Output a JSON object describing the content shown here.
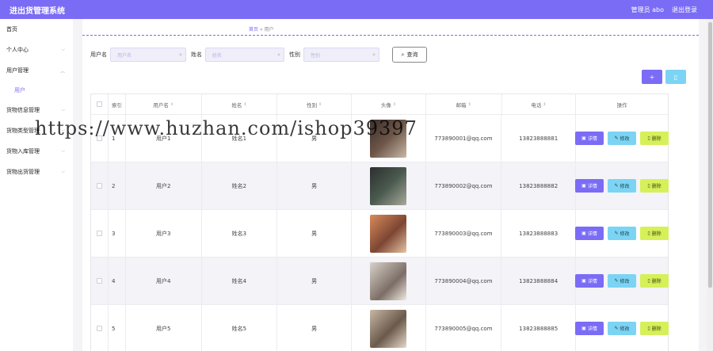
{
  "header": {
    "title": "进出货管理系统",
    "role_user": "管理员 abo",
    "logout": "退出登录"
  },
  "sidebar": {
    "items": [
      {
        "label": "首页",
        "has_chevron": false
      },
      {
        "label": "个人中心",
        "has_chevron": true
      },
      {
        "label": "用户管理",
        "has_chevron": true,
        "sub": "用户"
      },
      {
        "label": "货物信息管理",
        "has_chevron": true
      },
      {
        "label": "货物类型管理",
        "has_chevron": true
      },
      {
        "label": "货物入库管理",
        "has_chevron": true
      },
      {
        "label": "货物出货管理",
        "has_chevron": true
      }
    ]
  },
  "breadcrumb": {
    "home": "首页",
    "sep": "»",
    "current": "用户"
  },
  "search": {
    "username_label": "用户名",
    "username_placeholder": "用户名",
    "name_label": "姓名",
    "name_placeholder": "姓名",
    "gender_label": "性别",
    "gender_placeholder": "性别",
    "button": "查询"
  },
  "toolbar": {
    "add_icon": "plus-icon",
    "delete_icon": "trash-icon"
  },
  "table": {
    "headers": {
      "index": "索引",
      "username": "用户名",
      "name": "姓名",
      "gender": "性别",
      "avatar": "头像",
      "email": "邮箱",
      "phone": "电话",
      "ops": "操作"
    },
    "rows": [
      {
        "index": "1",
        "username": "用户1",
        "name": "姓名1",
        "gender": "男",
        "email": "773890001@qq.com",
        "phone": "13823888881"
      },
      {
        "index": "2",
        "username": "用户2",
        "name": "姓名2",
        "gender": "男",
        "email": "773890002@qq.com",
        "phone": "13823888882"
      },
      {
        "index": "3",
        "username": "用户3",
        "name": "姓名3",
        "gender": "男",
        "email": "773890003@qq.com",
        "phone": "13823888883"
      },
      {
        "index": "4",
        "username": "用户4",
        "name": "姓名4",
        "gender": "男",
        "email": "773890004@qq.com",
        "phone": "13823888884"
      },
      {
        "index": "5",
        "username": "用户5",
        "name": "姓名5",
        "gender": "男",
        "email": "773890005@qq.com",
        "phone": "13823888885"
      }
    ],
    "actions": {
      "detail": "详情",
      "edit": "修改",
      "delete": "删除"
    }
  },
  "watermark": "https://www.huzhan.com/ishop39397",
  "colors": {
    "primary": "#7b6cf6",
    "info": "#7cd4f4",
    "lime": "#d6f05a"
  }
}
